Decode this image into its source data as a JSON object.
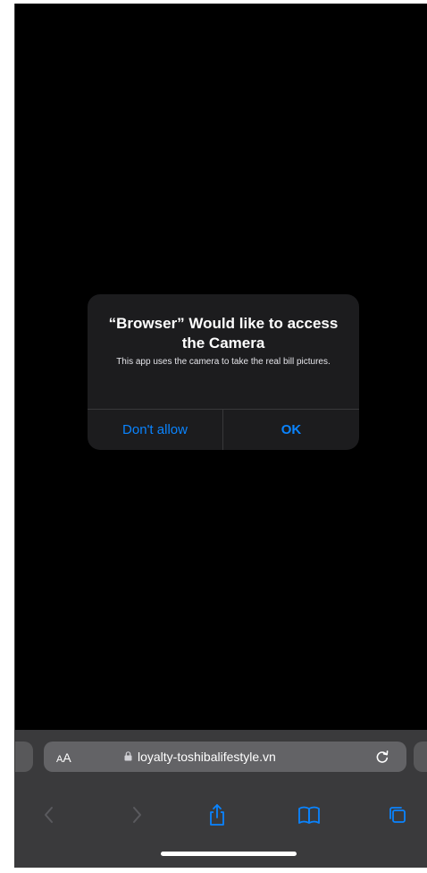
{
  "alert": {
    "title": "“Browser” Would like to access the Camera",
    "message": "This app uses the camera to take the real bill pictures.",
    "deny_label": "Don't allow",
    "allow_label": "OK"
  },
  "browser_bar": {
    "text_size_label_small": "A",
    "text_size_label_big": "A",
    "url": "loyalty-toshibalifestyle.vn"
  },
  "toolbar": {
    "icons": [
      "chevron-left-icon",
      "chevron-right-icon",
      "share-icon",
      "bookmarks-icon",
      "tabs-icon"
    ]
  },
  "colors": {
    "screen_background": "#000000",
    "alert_background": "#1c1c1e",
    "accent": "#0a84ff",
    "bar_background": "#3a3a3c",
    "address_field": "#636366"
  }
}
